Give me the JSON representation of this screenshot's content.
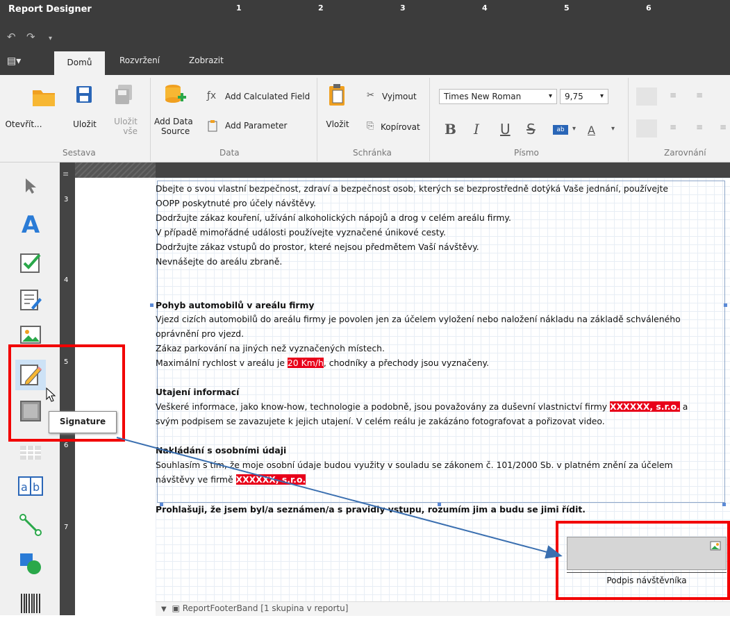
{
  "app": {
    "title": "Report Designer"
  },
  "quick_access": {
    "undo_icon": "undo-icon",
    "redo_icon": "redo-icon",
    "menu_icon": "chevron-down-icon"
  },
  "tabs": [
    {
      "label": "Domů"
    },
    {
      "label": "Rozvržení"
    },
    {
      "label": "Zobrazit"
    }
  ],
  "ribbon": {
    "report_group": {
      "label": "Sestava",
      "open": "Otevřít...",
      "save": "Uložit",
      "save_all_1": "Uložit",
      "save_all_2": "vše"
    },
    "data_group": {
      "label": "Data",
      "add_data_source_1": "Add Data",
      "add_data_source_2": "Source",
      "add_calculated_field": "Add Calculated Field",
      "add_parameter": "Add Parameter"
    },
    "clipboard_group": {
      "label": "Schránka",
      "paste": "Vložit",
      "cut": "Vyjmout",
      "copy": "Kopírovat"
    },
    "font_group": {
      "label": "Písmo",
      "font_name": "Times New Roman",
      "font_size": "9,75",
      "bold": "B",
      "italic": "I",
      "underline": "U",
      "strike": "S",
      "highlight": "ab",
      "font_color": "A"
    },
    "align_group": {
      "label": "Zarovnání"
    }
  },
  "ruler": {
    "h_numbers": [
      "1",
      "2",
      "3",
      "4",
      "5",
      "6"
    ],
    "v_numbers": [
      "3",
      "4",
      "5",
      "6",
      "7"
    ]
  },
  "toolbox": {
    "tooltip": "Signature"
  },
  "document": {
    "lines": [
      "Dbejte o svou vlastní bezpečnost, zdraví a bezpečnost osob, kterých se bezprostředně dotýká Vaše jednání, používejte",
      "OOPP poskytnuté pro účely návštěvy.",
      "Dodržujte zákaz kouření, užívání alkoholických nápojů a drog v celém areálu firmy.",
      "V případě mimořádné události používejte vyznačené únikové cesty.",
      "Dodržujte zákaz vstupů do prostor, které nejsou předmětem  Vaší návštěvy.",
      "Nevnášejte do areálu zbraně."
    ],
    "cars_heading": "Pohyb automobilů v areálu firmy",
    "cars_lines": [
      "Vjezd cizích automobilů do areálu firmy je povolen jen za účelem vyložení nebo naložení nákladu na základě schváleného",
      "oprávnění pro vjezd.",
      "Zákaz parkování na jiných než vyznačených místech."
    ],
    "speed_prefix": "Maximální rychlost v areálu je ",
    "speed_value": "20 Km/h",
    "speed_suffix": ", chodníky a přechody jsou vyznačeny.",
    "secrecy_heading": "Utajení informací",
    "secrecy_prefix": "Veškeré  informace, jako know-how, technologie a podobně, jsou považovány za duševní vlastnictví firmy ",
    "company": "XXXXXX, s.r.o.",
    "secrecy_suffix": " a",
    "secrecy_line2": "svým podpisem se zavazujete k jejich utajení. V celém reálu je zakázáno fotografovat a pořizovat video.",
    "personal_heading": "Nakládání  s osobními údaji",
    "personal_line1": "Souhlasím s tím, že moje osobní údaje budou využity v souladu se zákonem č. 101/2000 Sb. v platném znění za účelem",
    "personal_prefix": "návštěvy ve firmě ",
    "declaration": "Prohlašuji,  že jsem byl/a seznámen/a s pravidly  vstupu, rozumím jim a budu se jimi řídit."
  },
  "signature": {
    "label": "Podpis návštěvníka"
  },
  "footer_band": {
    "label": "ReportFooterBand [1 skupina v reportu]"
  },
  "colors": {
    "accent_red": "#f20000",
    "highlight": "#e8001a",
    "dark_chrome": "#3c3c3c"
  }
}
